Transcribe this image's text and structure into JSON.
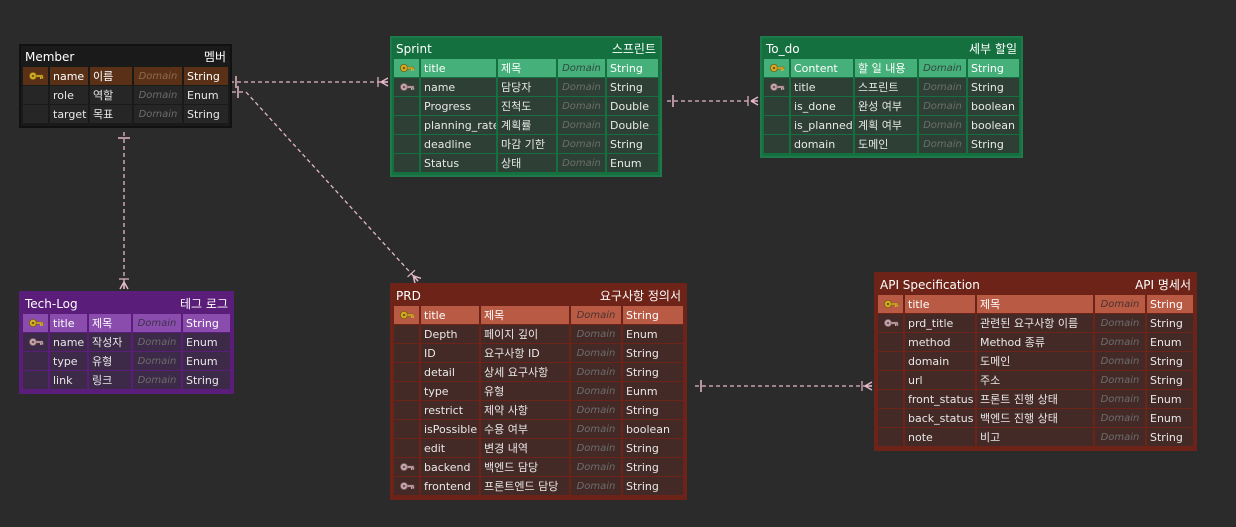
{
  "colors": {
    "background": "#2b2b2b",
    "connector": "#e4b8c8",
    "member": {
      "border": "#111111",
      "header": "#1a1a1a",
      "cell": "#262626",
      "hl": "#5a3116"
    },
    "sprint": {
      "border": "#1e7a4a",
      "header": "#14703f",
      "cell": "#2e4036",
      "hl": "#46b07a"
    },
    "todo": {
      "border": "#1e7a4a",
      "header": "#14703f",
      "cell": "#2e4036",
      "hl": "#46b07a"
    },
    "techlog": {
      "border": "#5a1d7a",
      "header": "#5a1d7a",
      "cell": "#3c2a48",
      "hl": "#8a4dae"
    },
    "prd": {
      "border": "#6e2318",
      "header": "#6e2318",
      "cell": "#442a26",
      "hl": "#b85a44"
    },
    "api": {
      "border": "#6e2318",
      "header": "#6e2318",
      "cell": "#442a26",
      "hl": "#b85a44"
    }
  },
  "tables": [
    {
      "id": "member",
      "name": "Member",
      "alias": "멤버",
      "theme": "member",
      "rows": [
        {
          "key": "primary",
          "name": "name",
          "alias": "이름",
          "domain": "Domain",
          "type": "String",
          "hl": true
        },
        {
          "key": "none",
          "name": "role",
          "alias": "역할",
          "domain": "Domain",
          "type": "Enum"
        },
        {
          "key": "none",
          "name": "target",
          "alias": "목표",
          "domain": "Domain",
          "type": "String"
        }
      ]
    },
    {
      "id": "sprint",
      "name": "Sprint",
      "alias": "스프린트",
      "theme": "sprint",
      "rows": [
        {
          "key": "primary",
          "name": "title",
          "alias": "제목",
          "domain": "Domain",
          "type": "String",
          "hl": true
        },
        {
          "key": "foreign",
          "name": "name",
          "alias": "담당자",
          "domain": "Domain",
          "type": "String"
        },
        {
          "key": "none",
          "name": "Progress",
          "alias": "진척도",
          "domain": "Domain",
          "type": "Double"
        },
        {
          "key": "none",
          "name": "planning_rate",
          "alias": "계획률",
          "domain": "Domain",
          "type": "Double"
        },
        {
          "key": "none",
          "name": "deadline",
          "alias": "마감 기한",
          "domain": "Domain",
          "type": "String"
        },
        {
          "key": "none",
          "name": "Status",
          "alias": "상태",
          "domain": "Domain",
          "type": "Enum"
        }
      ]
    },
    {
      "id": "todo",
      "name": "To_do",
      "alias": "세부 할일",
      "theme": "todo",
      "rows": [
        {
          "key": "primary",
          "name": "Content",
          "alias": "할 일 내용",
          "domain": "Domain",
          "type": "String",
          "hl": true
        },
        {
          "key": "foreign",
          "name": "title",
          "alias": "스프린트",
          "domain": "Domain",
          "type": "String"
        },
        {
          "key": "none",
          "name": "is_done",
          "alias": "완성 여부",
          "domain": "Domain",
          "type": "boolean"
        },
        {
          "key": "none",
          "name": "is_planned",
          "alias": "계획 여부",
          "domain": "Domain",
          "type": "boolean"
        },
        {
          "key": "none",
          "name": "domain",
          "alias": "도메인",
          "domain": "Domain",
          "type": "String"
        }
      ]
    },
    {
      "id": "techlog",
      "name": "Tech-Log",
      "alias": "테그 로그",
      "theme": "techlog",
      "rows": [
        {
          "key": "primary",
          "name": "title",
          "alias": "제목",
          "domain": "Domain",
          "type": "String",
          "hl": true
        },
        {
          "key": "foreign",
          "name": "name",
          "alias": "작성자",
          "domain": "Domain",
          "type": "Enum"
        },
        {
          "key": "none",
          "name": "type",
          "alias": "유형",
          "domain": "Domain",
          "type": "Enum"
        },
        {
          "key": "none",
          "name": "link",
          "alias": "링크",
          "domain": "Domain",
          "type": "String"
        }
      ]
    },
    {
      "id": "prd",
      "name": "PRD",
      "alias": "요구사항 정의서",
      "theme": "prd",
      "rows": [
        {
          "key": "primary",
          "name": "title",
          "alias": "제목",
          "domain": "Domain",
          "type": "String",
          "hl": true
        },
        {
          "key": "none",
          "name": "Depth",
          "alias": "페이지 깊이",
          "domain": "Domain",
          "type": "Enum"
        },
        {
          "key": "none",
          "name": "ID",
          "alias": "요구사항 ID",
          "domain": "Domain",
          "type": "String"
        },
        {
          "key": "none",
          "name": "detail",
          "alias": "상세 요구사항",
          "domain": "Domain",
          "type": "String"
        },
        {
          "key": "none",
          "name": "type",
          "alias": "유형",
          "domain": "Domain",
          "type": "Eunm"
        },
        {
          "key": "none",
          "name": "restrict",
          "alias": "제약 사항",
          "domain": "Domain",
          "type": "String"
        },
        {
          "key": "none",
          "name": "isPossible",
          "alias": "수용 여부",
          "domain": "Domain",
          "type": "boolean"
        },
        {
          "key": "none",
          "name": "edit",
          "alias": "변경 내역",
          "domain": "Domain",
          "type": "String"
        },
        {
          "key": "foreign",
          "name": "backend",
          "alias": "백엔드 담당",
          "domain": "Domain",
          "type": "String"
        },
        {
          "key": "foreign",
          "name": "frontend",
          "alias": "프론트엔드 담당",
          "domain": "Domain",
          "type": "String"
        }
      ]
    },
    {
      "id": "api",
      "name": "API Specification",
      "alias": "API 명세서",
      "theme": "api",
      "rows": [
        {
          "key": "primary",
          "name": "title",
          "alias": "제목",
          "domain": "Domain",
          "type": "String",
          "hl": true
        },
        {
          "key": "foreign",
          "name": "prd_title",
          "alias": "관련된 요구사항 이름",
          "domain": "Domain",
          "type": "String"
        },
        {
          "key": "none",
          "name": "method",
          "alias": "Method 종류",
          "domain": "Domain",
          "type": "Enum"
        },
        {
          "key": "none",
          "name": "domain",
          "alias": "도메인",
          "domain": "Domain",
          "type": "String"
        },
        {
          "key": "none",
          "name": "url",
          "alias": "주소",
          "domain": "Domain",
          "type": "String"
        },
        {
          "key": "none",
          "name": "front_status",
          "alias": "프론트 진행 상태",
          "domain": "Domain",
          "type": "Enum"
        },
        {
          "key": "none",
          "name": "back_status",
          "alias": "백엔드 진행 상태",
          "domain": "Domain",
          "type": "Enum"
        },
        {
          "key": "none",
          "name": "note",
          "alias": "비고",
          "domain": "Domain",
          "type": "String"
        }
      ]
    }
  ],
  "relationships": [
    {
      "from": "member",
      "to": "sprint"
    },
    {
      "from": "member",
      "to": "techlog"
    },
    {
      "from": "member",
      "to": "prd"
    },
    {
      "from": "sprint",
      "to": "todo"
    },
    {
      "from": "prd",
      "to": "api"
    }
  ]
}
